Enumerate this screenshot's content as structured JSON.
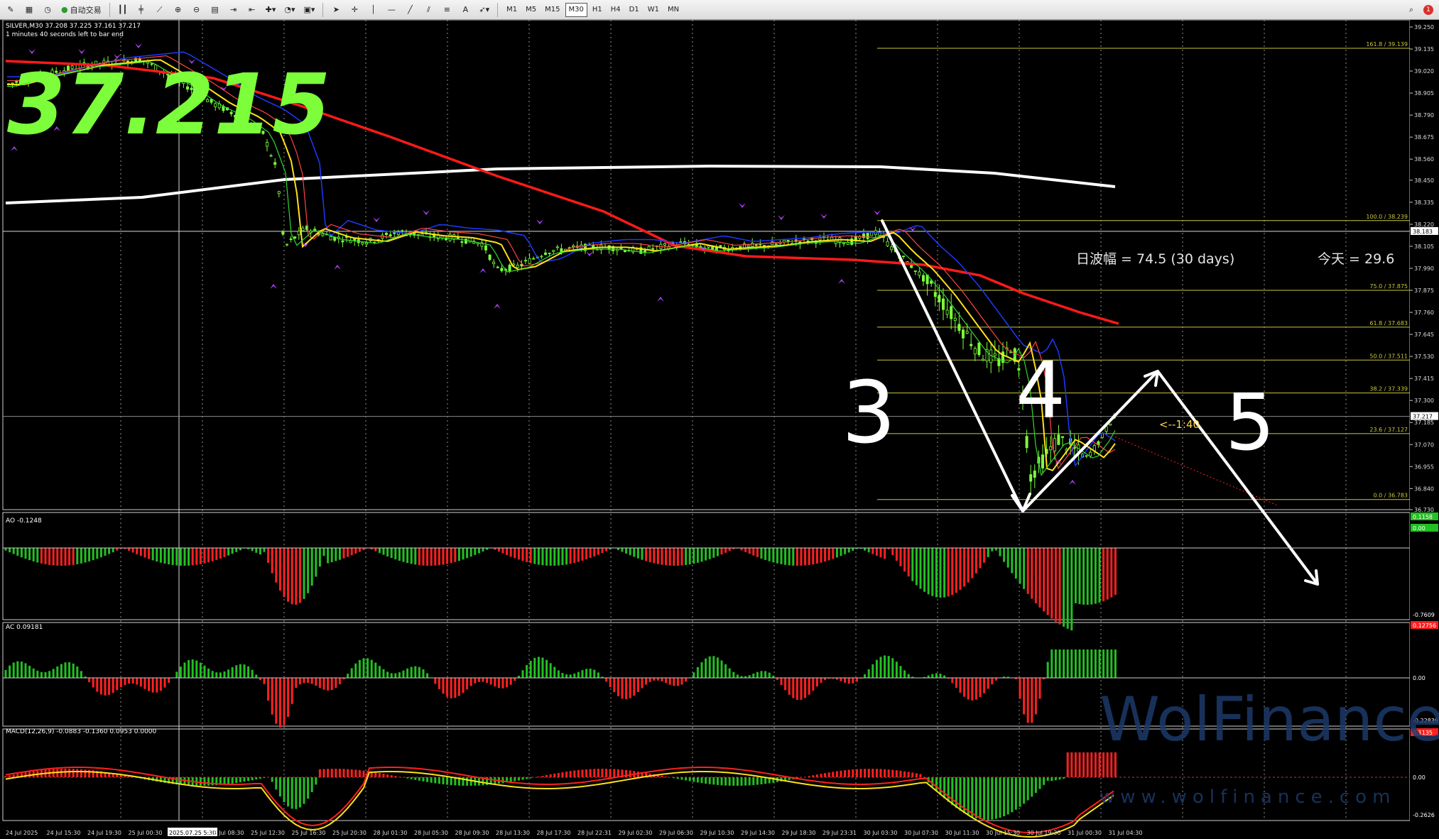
{
  "toolbar": {
    "auto_trading_label": "自动交易",
    "periods": [
      "M1",
      "M5",
      "M15",
      "M30",
      "H1",
      "H4",
      "D1",
      "W1",
      "MN"
    ],
    "active_period": "M30",
    "alert_count": "1"
  },
  "chart": {
    "symbol_line": "SILVER,M30  37.208 37.225 37.161 37.217",
    "timer_line": "1 minutes 40 seconds left to bar end",
    "big_price": "37.215",
    "range_text": "日波幅 = 74.5  (30 days)",
    "today_text": "今天 = 29.6",
    "countdown_label": "<--1:40",
    "wave_labels": [
      "3",
      "4",
      "5"
    ],
    "fib_levels": [
      {
        "label": "161.8 / 39.139",
        "price": 39.139
      },
      {
        "label": "100.0 / 38.239",
        "price": 38.239
      },
      {
        "label": "75.0 / 37.875",
        "price": 37.875
      },
      {
        "label": "61.8 / 37.683",
        "price": 37.683
      },
      {
        "label": "50.0 / 37.511",
        "price": 37.511
      },
      {
        "label": "38.2 / 37.339",
        "price": 37.339
      },
      {
        "label": "23.6 / 37.127",
        "price": 37.127
      },
      {
        "label": "0.0 / 36.783",
        "price": 36.783
      }
    ],
    "price_scale": [
      "39.250",
      "39.135",
      "39.020",
      "38.905",
      "38.790",
      "38.675",
      "38.560",
      "38.450",
      "38.335",
      "38.220",
      "38.105",
      "37.990",
      "37.875",
      "37.760",
      "37.645",
      "37.530",
      "37.415",
      "37.300",
      "37.185",
      "37.070",
      "36.955",
      "36.840",
      "36.730"
    ],
    "crosshair_price": "38.183",
    "current_price": "37.217",
    "price_range": [
      36.73,
      39.25
    ],
    "colors": {
      "candle": "#7cff3a",
      "ma_red": "#ff1a1a",
      "ma_white": "#ffffff",
      "ma_yellow": "#ffe11a",
      "ma_blue": "#1d39ff",
      "ma_green": "#2fd82f",
      "fib": "#c8c83c",
      "big_price": "#7cff3a",
      "arrow_purple": "#b040ff",
      "countdown": "#ffd34d"
    }
  },
  "ao_panel": {
    "label": "AO -0.1248",
    "scale_top": "0.1158",
    "scale_zero": "0.00",
    "scale_bottom": "-0.7609"
  },
  "ac_panel": {
    "label": "AC 0.09181",
    "scale_top": "0.12756",
    "scale_zero": "0.00",
    "scale_bottom": "-0.22839"
  },
  "macd_panel": {
    "label": "MACD(12,26,9) -0.0883 -0.1360 0.0953 0.0000",
    "scale_top": "0.1135",
    "scale_zero": "0.00",
    "scale_bottom": "-0.2626"
  },
  "time_axis": [
    "24 Jul 2025",
    "24 Jul 15:30",
    "24 Jul 19:30",
    "25 Jul 00:30",
    "2025.07.25 5:30",
    "25 Jul 08:30",
    "25 Jul 12:30",
    "25 Jul 16:30",
    "25 Jul 20:30",
    "28 Jul 01:30",
    "28 Jul 05:30",
    "28 Jul 09:30",
    "28 Jul 13:30",
    "28 Jul 17:30",
    "28 Jul 22:31",
    "29 Jul 02:30",
    "29 Jul 06:30",
    "29 Jul 10:30",
    "29 Jul 14:30",
    "29 Jul 18:30",
    "29 Jul 23:31",
    "30 Jul 03:30",
    "30 Jul 07:30",
    "30 Jul 11:30",
    "30 Jul 15:30",
    "30 Jul 19:30",
    "31 Jul 00:30",
    "31 Jul 04:30"
  ],
  "watermark": {
    "brand": "WolFinance",
    "url": "www.wolfinance.com"
  }
}
